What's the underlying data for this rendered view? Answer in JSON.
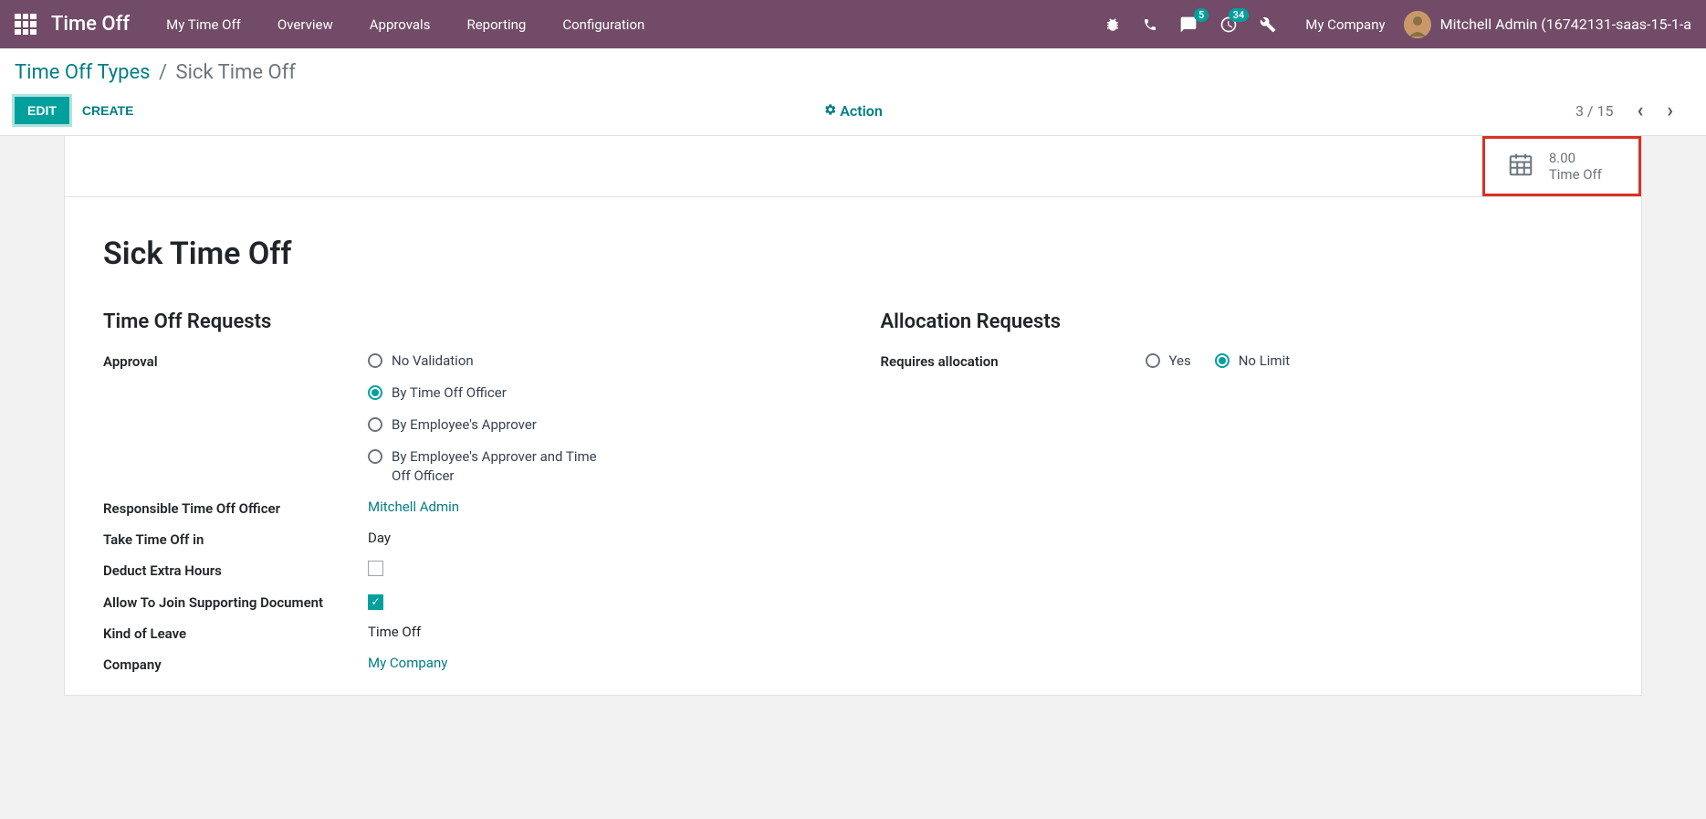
{
  "navbar": {
    "app_title": "Time Off",
    "items": [
      "My Time Off",
      "Overview",
      "Approvals",
      "Reporting",
      "Configuration"
    ],
    "badge_messages": "5",
    "badge_activities": "34",
    "company": "My Company",
    "user": "Mitchell Admin (16742131-saas-15-1-a"
  },
  "breadcrumb": {
    "parent": "Time Off Types",
    "current": "Sick Time Off"
  },
  "controls": {
    "edit": "EDIT",
    "create": "CREATE",
    "action": "Action",
    "pager": "3 / 15"
  },
  "stat": {
    "value": "8.00",
    "label": "Time Off"
  },
  "record": {
    "title": "Sick Time Off"
  },
  "sections": {
    "requests": "Time Off Requests",
    "allocation": "Allocation Requests"
  },
  "fields": {
    "approval_label": "Approval",
    "approval_options": [
      "No Validation",
      "By Time Off Officer",
      "By Employee's Approver",
      "By Employee's Approver and Time Off Officer"
    ],
    "approval_selected": 1,
    "responsible_label": "Responsible Time Off Officer",
    "responsible_value": "Mitchell Admin",
    "take_label": "Take Time Off in",
    "take_value": "Day",
    "deduct_label": "Deduct Extra Hours",
    "deduct_checked": false,
    "allow_label": "Allow To Join Supporting Document",
    "allow_checked": true,
    "kind_label": "Kind of Leave",
    "kind_value": "Time Off",
    "company_label": "Company",
    "company_value": "My Company",
    "requires_label": "Requires allocation",
    "requires_options": [
      "Yes",
      "No Limit"
    ],
    "requires_selected": 1
  }
}
